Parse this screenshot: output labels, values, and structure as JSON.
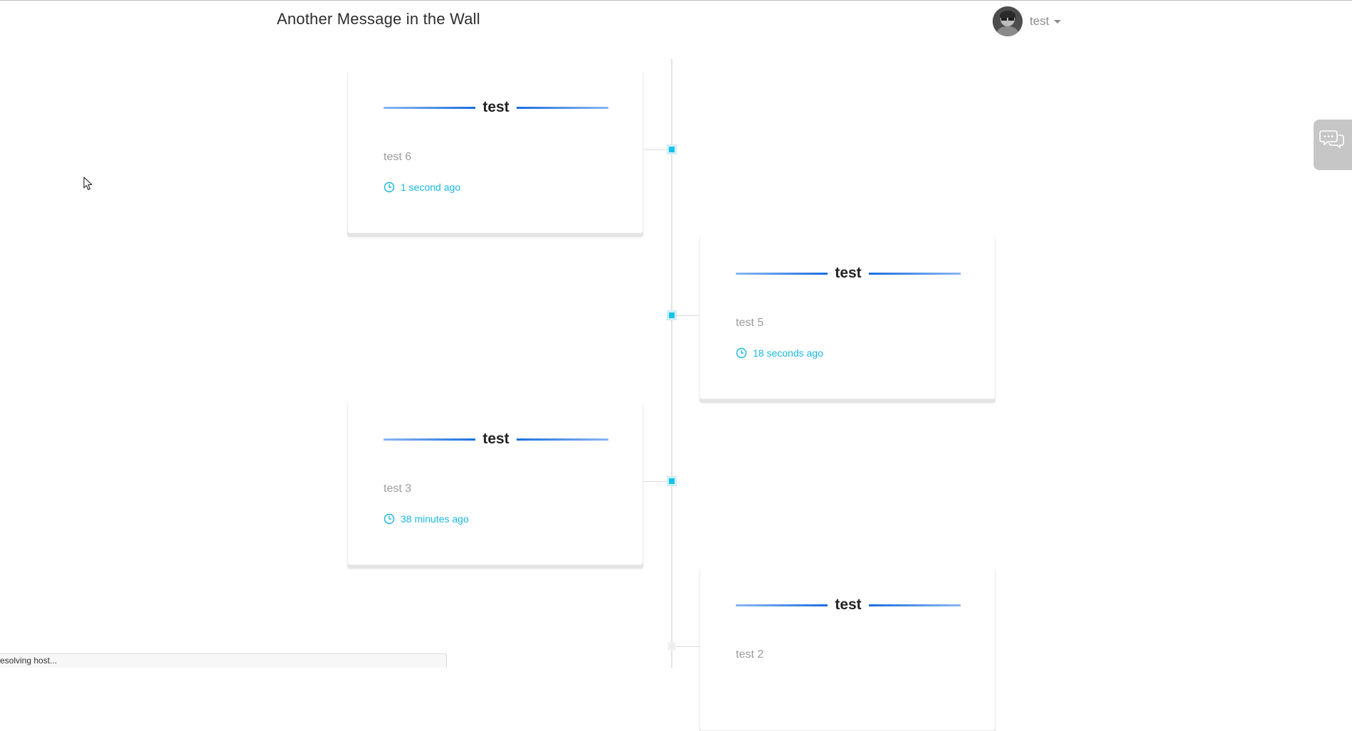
{
  "header": {
    "brand": "Another Message in the Wall",
    "user": {
      "name": "test"
    }
  },
  "posts": [
    {
      "title": "test",
      "message": "test 6",
      "time": "1 second ago"
    },
    {
      "title": "test",
      "message": "test 5",
      "time": "18 seconds ago"
    },
    {
      "title": "test",
      "message": "test 3",
      "time": "38 minutes ago"
    },
    {
      "title": "test",
      "message": "test 2",
      "time": ""
    }
  ],
  "status_bar": {
    "text": "esolving host..."
  },
  "colors": {
    "accent": "#18b7e4",
    "title_line": "#1a6fe0",
    "chat_tab": "#c6c6c6"
  },
  "icons": {
    "user_menu": "chevron-down-icon",
    "chat": "chat-bubbles-icon",
    "time": "clock-icon"
  }
}
